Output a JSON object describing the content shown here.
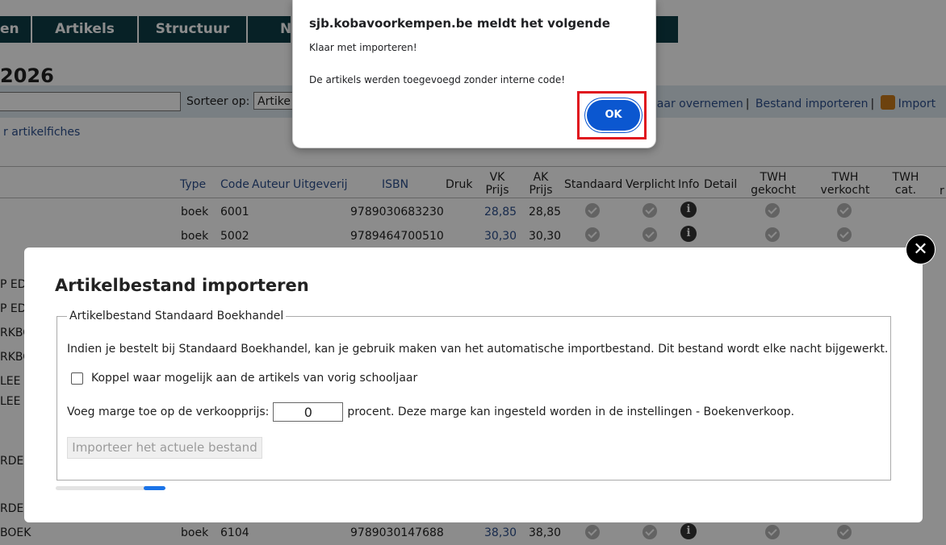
{
  "nav": {
    "items": [
      "en",
      "Artikels",
      "Structuur",
      "Ni"
    ]
  },
  "page_title": "2026",
  "toolbar": {
    "sort_label": "Sorteer op:",
    "sort_value": "Artike",
    "links": [
      "ljaar overnemen",
      "Bestand importeren",
      "Import"
    ]
  },
  "fiches_link": "r artikelfiches",
  "table": {
    "headers": {
      "type": "Type",
      "code": "Code",
      "auteur": "Auteur",
      "uitgeverij": "Uitgeverij",
      "isbn": "ISBN",
      "druk": "Druk",
      "vk": [
        "VK",
        "Prijs"
      ],
      "ak": [
        "AK",
        "Prijs"
      ],
      "standaard": "Standaard",
      "verplicht": "Verplicht",
      "info": "Info",
      "detail": "Detail",
      "twh_gekocht": [
        "TWH",
        "gekocht"
      ],
      "twh_verkocht": [
        "TWH",
        "verkocht"
      ],
      "twh_cat": [
        "TWH",
        "cat."
      ],
      "r": "r"
    },
    "rows": [
      {
        "type": "boek",
        "code": "6001",
        "isbn": "9789030683230",
        "vk": "28,85",
        "ak": "28,85"
      },
      {
        "type": "boek",
        "code": "5002",
        "isbn": "9789464700510",
        "vk": "30,30",
        "ak": "30,30"
      },
      {
        "title": "BOEK",
        "type": "boek",
        "code": "6104",
        "isbn": "9789030147688",
        "vk": "38,30",
        "ak": "38,30"
      }
    ],
    "left_fragments": [
      "P ED",
      "P ED",
      "RKBO",
      "RKBO",
      "LEE",
      "LEE",
      "RDE",
      "RDE"
    ]
  },
  "modal": {
    "title": "Artikelbestand importeren",
    "legend": "Artikelbestand Standaard Boekhandel",
    "description": "Indien je bestelt bij Standaard Boekhandel, kan je gebruik maken van het automatische importbestand. Dit bestand wordt elke nacht bijgewerkt.",
    "checkbox_label": "Koppel waar mogelijk aan de artikels van vorig schooljaar",
    "margin_label": "Voeg marge toe op de verkoopprijs:",
    "margin_value": "0",
    "margin_suffix": "procent. Deze marge kan ingesteld worden in de instellingen - Boekenverkoop.",
    "import_button": "Importeer het actuele bestand",
    "close_symbol": "✕",
    "progress_percent": 20
  },
  "alert": {
    "title": "sjb.kobavoorkempen.be meldt het volgende",
    "message1": "Klaar met importeren!",
    "message2": "De artikels werden toegevoegd zonder interne code!",
    "ok": "OK"
  },
  "colors": {
    "nav_bg": "#0e3c46",
    "link": "#2c4f8c",
    "ok_button": "#0b57d0",
    "highlight": "#e0141e"
  }
}
